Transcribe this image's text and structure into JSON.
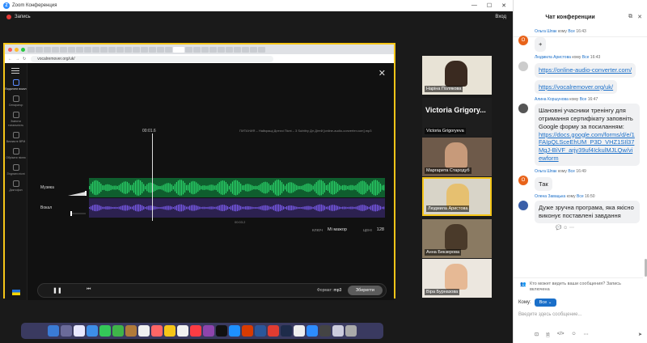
{
  "window": {
    "title": "Zoom Конференция",
    "minimize": "—",
    "maximize": "☐",
    "close": "✕"
  },
  "toolbar": {
    "recording_label": "Запись",
    "exit_label": "Вход"
  },
  "browser": {
    "url": "vocalremover.org/uk/"
  },
  "vocalremover": {
    "sidebar": [
      {
        "label": "Видалити вокал"
      },
      {
        "label": "Сепаратор"
      },
      {
        "label": "Змінити тональність"
      },
      {
        "label": "Визначте BPM"
      },
      {
        "label": "Обрізати пісню"
      },
      {
        "label": "З'єднати пісні"
      },
      {
        "label": "Диктофон"
      }
    ],
    "time": "00:01.6",
    "filename": "ПИТАНИЯ – Найкращі Дитячі Пісні – 3 Subtitry Дл Дітей [online-audio-converter.com].mp3",
    "music_label": "Музика",
    "vocal_label": "Вокал",
    "mark_a": "00:01.6",
    "mark_b": "00:03.2",
    "key_label": "КЛЮЧ",
    "key_value": "Мі мажор",
    "bpm_label": "ЦЕНІ",
    "bpm_value": "128",
    "format_label": "Формат:",
    "format_value": "mp3",
    "save_label": "Зберегти"
  },
  "participants": [
    {
      "name": "Наріна Полякова"
    },
    {
      "name": "Victoria Grigoryeva",
      "big": "Victoria Grigory..."
    },
    {
      "name": "Маргарита Стародуб"
    },
    {
      "name": "Людмила Аристова"
    },
    {
      "name": "Анна Бекзерова"
    },
    {
      "name": "Віра Бурназова"
    }
  ],
  "chat": {
    "title": "Чат конференции",
    "messages": [
      {
        "sender": "Ольга Шпак",
        "to_word": "кому",
        "to": "Все",
        "time": "16:43",
        "initial": "О",
        "text": "+"
      },
      {
        "sender": "Людмила Аристова",
        "to_word": "кому",
        "to": "Все",
        "time": "16:43",
        "initial": "",
        "links": [
          "https://online-audio-converter.com/",
          "https://vocalremover.org/uk/"
        ]
      },
      {
        "sender": "Алина Коршунова",
        "to_word": "кому",
        "to": "Все",
        "time": "16:47",
        "initial": "",
        "text": "Шановні учасники тренінгу для отримання сертифікату заповніть Google форму за посиланням:",
        "link": "https://docs.google.com/forms/d/e/1FAIpQLSceEhUM_P3D_VHZ1SIl37MgJ-BiVF_arjy39uf4IckulMJLQw/viewform"
      },
      {
        "sender": "Ольга Шпак",
        "to_word": "кому",
        "to": "Все",
        "time": "16:49",
        "initial": "О",
        "text": "Так"
      },
      {
        "sender": "Олена Завацька",
        "to_word": "кому",
        "to": "Все",
        "time": "16:50",
        "initial": "",
        "text": "Дуже зручна програма, яка якісно виконує поставлені завдання"
      }
    ],
    "notice": "Кто может видеть ваши сообщения? Запись включена",
    "to_label": "Кому:",
    "to_value": "Все",
    "input_placeholder": "Введите здесь сообщение..."
  },
  "colors": {
    "accent": "#1a6fc9",
    "highlight": "#f5c518",
    "record": "#e53935",
    "music_wave": "#2bd46a",
    "vocal_wave": "#7c5cf0"
  }
}
